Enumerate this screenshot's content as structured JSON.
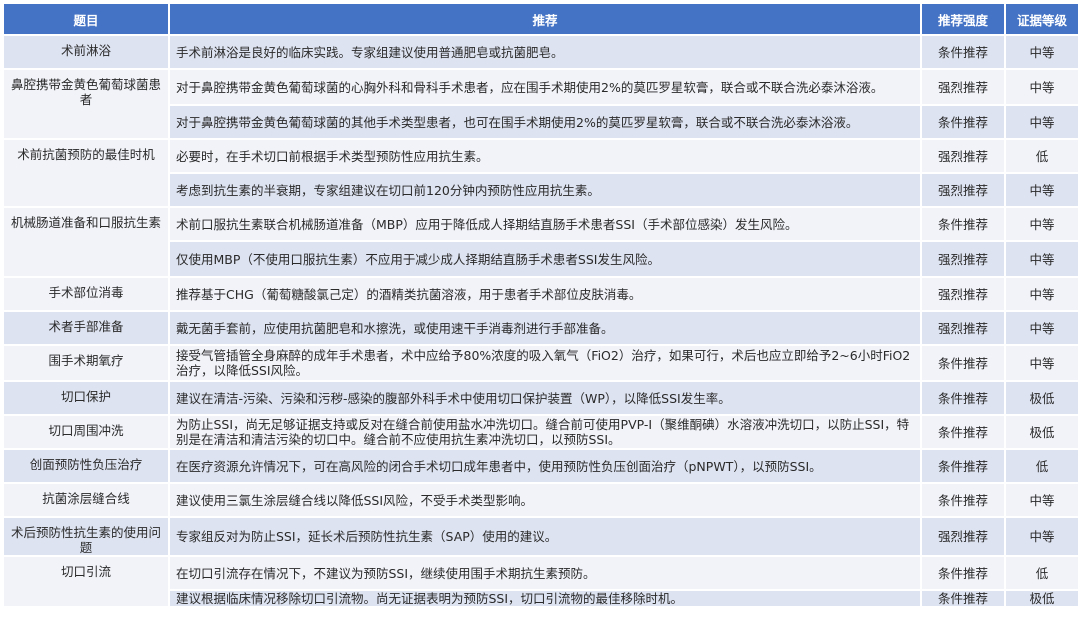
{
  "headers": {
    "topic": "题目",
    "recommendation": "推荐",
    "strength": "推荐强度",
    "evidence": "证据等级"
  },
  "groups": [
    {
      "topic": "术前淋浴",
      "rows": [
        {
          "rec": "手术前淋浴是良好的临床实践。专家组建议使用普通肥皂或抗菌肥皂。",
          "strength": "条件推荐",
          "level": "中等"
        }
      ]
    },
    {
      "topic": "鼻腔携带金黄色葡萄球菌患者",
      "rows": [
        {
          "rec": "对于鼻腔携带金黄色葡萄球菌的心胸外科和骨科手术患者，应在围手术期使用2%的莫匹罗星软膏，联合或不联合洗必泰沐浴液。",
          "strength": "强烈推荐",
          "level": "中等"
        },
        {
          "rec": "对于鼻腔携带金黄色葡萄球菌的其他手术类型患者，也可在围手术期使用2%的莫匹罗星软膏，联合或不联合洗必泰沐浴液。",
          "strength": "条件推荐",
          "level": "中等"
        }
      ]
    },
    {
      "topic": "术前抗菌预防的最佳时机",
      "rows": [
        {
          "rec": "必要时，在手术切口前根据手术类型预防性应用抗生素。",
          "strength": "强烈推荐",
          "level": "低"
        },
        {
          "rec": "考虑到抗生素的半衰期，专家组建议在切口前120分钟内预防性应用抗生素。",
          "strength": "强烈推荐",
          "level": "中等"
        }
      ]
    },
    {
      "topic": "机械肠道准备和口服抗生素",
      "rows": [
        {
          "rec": "术前口服抗生素联合机械肠道准备（MBP）应用于降低成人择期结直肠手术患者SSI（手术部位感染）发生风险。",
          "strength": "条件推荐",
          "level": "中等"
        },
        {
          "rec": "仅使用MBP（不使用口服抗生素）不应用于减少成人择期结直肠手术患者SSI发生风险。",
          "strength": "强烈推荐",
          "level": "中等"
        }
      ]
    },
    {
      "topic": "手术部位消毒",
      "rows": [
        {
          "rec": "推荐基于CHG（葡萄糖酸氯己定）的酒精类抗菌溶液，用于患者手术部位皮肤消毒。",
          "strength": "强烈推荐",
          "level": "中等"
        }
      ]
    },
    {
      "topic": "术者手部准备",
      "rows": [
        {
          "rec": "戴无菌手套前，应使用抗菌肥皂和水擦洗，或使用速干手消毒剂进行手部准备。",
          "strength": "强烈推荐",
          "level": "中等"
        }
      ]
    },
    {
      "topic": "围手术期氧疗",
      "rows": [
        {
          "rec": "接受气管插管全身麻醉的成年手术患者，术中应给予80%浓度的吸入氧气（FiO2）治疗，如果可行，术后也应立即给予2~6小时FiO2治疗，以降低SSI风险。",
          "strength": "条件推荐",
          "level": "中等"
        }
      ]
    },
    {
      "topic": "切口保护",
      "rows": [
        {
          "rec": "建议在清洁-污染、污染和污秽-感染的腹部外科手术中使用切口保护装置（WP），以降低SSI发生率。",
          "strength": "条件推荐",
          "level": "极低"
        }
      ]
    },
    {
      "topic": "切口周围冲洗",
      "rows": [
        {
          "rec": "为防止SSI，尚无足够证据支持或反对在缝合前使用盐水冲洗切口。缝合前可使用PVP-I（聚维酮碘）水溶液冲洗切口，以防止SSI，特别是在清洁和清洁污染的切口中。缝合前不应使用抗生素冲洗切口，以预防SSI。",
          "strength": "条件推荐",
          "level": "极低"
        }
      ]
    },
    {
      "topic": "创面预防性负压治疗",
      "rows": [
        {
          "rec": "在医疗资源允许情况下，可在高风险的闭合手术切口成年患者中，使用预防性负压创面治疗（pNPWT），以预防SSI。",
          "strength": "条件推荐",
          "level": "低"
        }
      ]
    },
    {
      "topic": "抗菌涂层缝合线",
      "rows": [
        {
          "rec": "建议使用三氯生涂层缝合线以降低SSI风险，不受手术类型影响。",
          "strength": "条件推荐",
          "level": "中等"
        }
      ]
    },
    {
      "topic": "术后预防性抗生素的使用问题",
      "rows": [
        {
          "rec": "专家组反对为防止SSI，延长术后预防性抗生素（SAP）使用的建议。",
          "strength": "强烈推荐",
          "level": "中等"
        }
      ]
    },
    {
      "topic": "切口引流",
      "rows": [
        {
          "rec": "在切口引流存在情况下，不建议为预防SSI，继续使用围手术期抗生素预防。",
          "strength": "条件推荐",
          "level": "低"
        },
        {
          "rec": "建议根据临床情况移除切口引流物。尚无证据表明为预防SSI，切口引流物的最佳移除时机。",
          "strength": "条件推荐",
          "level": "极低"
        }
      ]
    }
  ]
}
